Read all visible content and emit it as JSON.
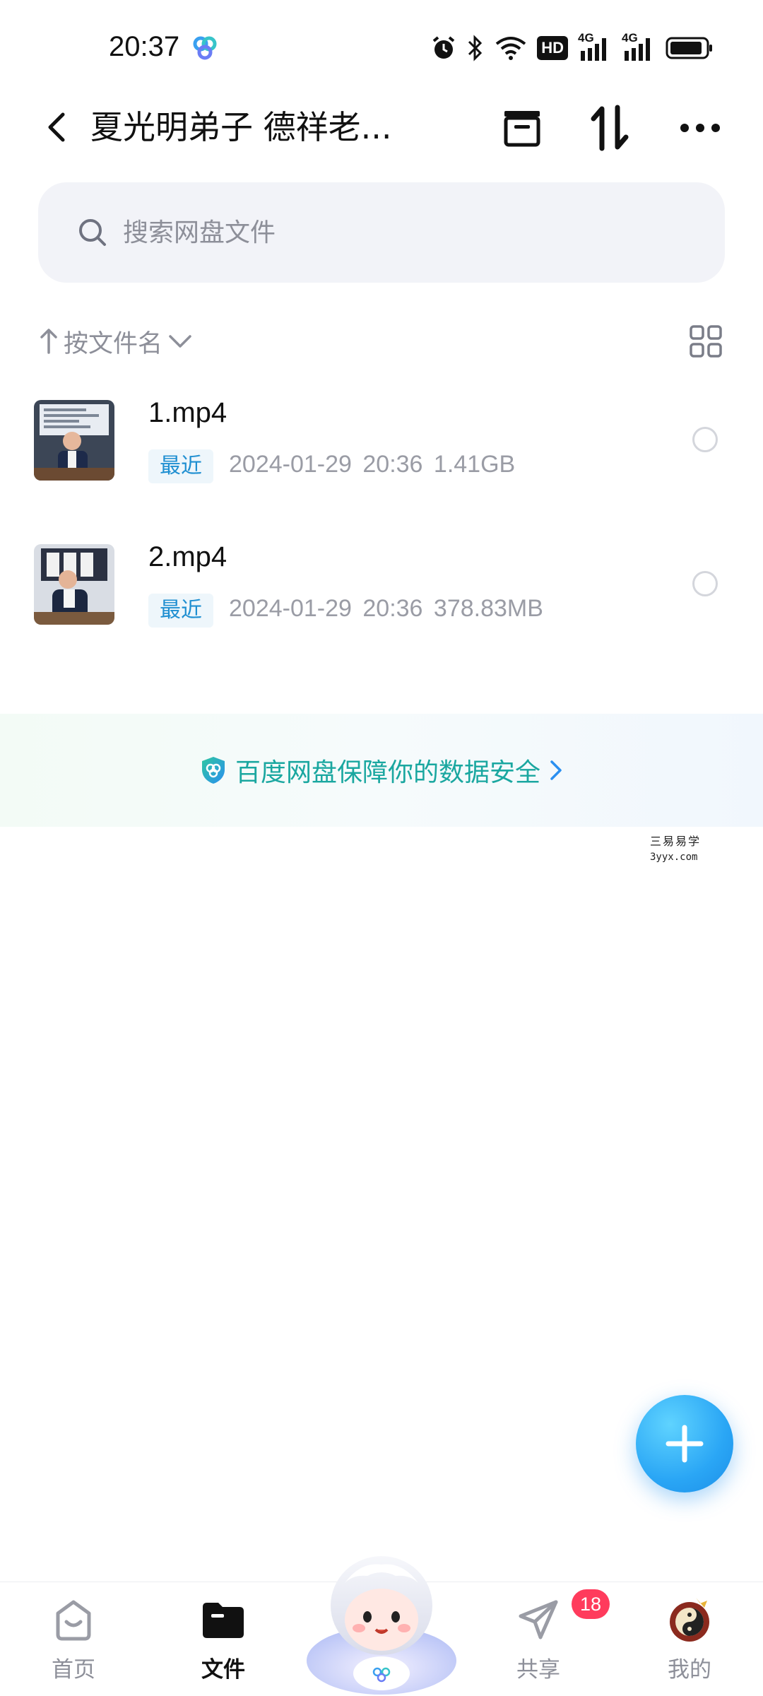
{
  "status_bar": {
    "time": "20:37",
    "hd_label": "HD",
    "network_1": "4G",
    "network_2": "4G"
  },
  "header": {
    "title": "夏光明弟子 德祥老..."
  },
  "search": {
    "placeholder": "搜索网盘文件"
  },
  "sort": {
    "label": "按文件名"
  },
  "files": [
    {
      "name": "1.mp4",
      "badge": "最近",
      "date": "2024-01-29",
      "time": "20:36",
      "size": "1.41GB"
    },
    {
      "name": "2.mp4",
      "badge": "最近",
      "date": "2024-01-29",
      "time": "20:36",
      "size": "378.83MB"
    }
  ],
  "security_banner": {
    "text": "百度网盘保障你的数据安全"
  },
  "watermark": {
    "line1": "三易易学",
    "line2": "3yyx.com"
  },
  "bottom_nav": {
    "items": [
      {
        "label": "首页"
      },
      {
        "label": "文件"
      },
      {
        "label": "共享",
        "badge": "18"
      },
      {
        "label": "我的"
      }
    ]
  },
  "colors": {
    "accent": "#1f8fd1",
    "security_green": "#1aa7a0",
    "badge_red": "#ff3b5c",
    "fab_blue": "#2aa6f5"
  }
}
